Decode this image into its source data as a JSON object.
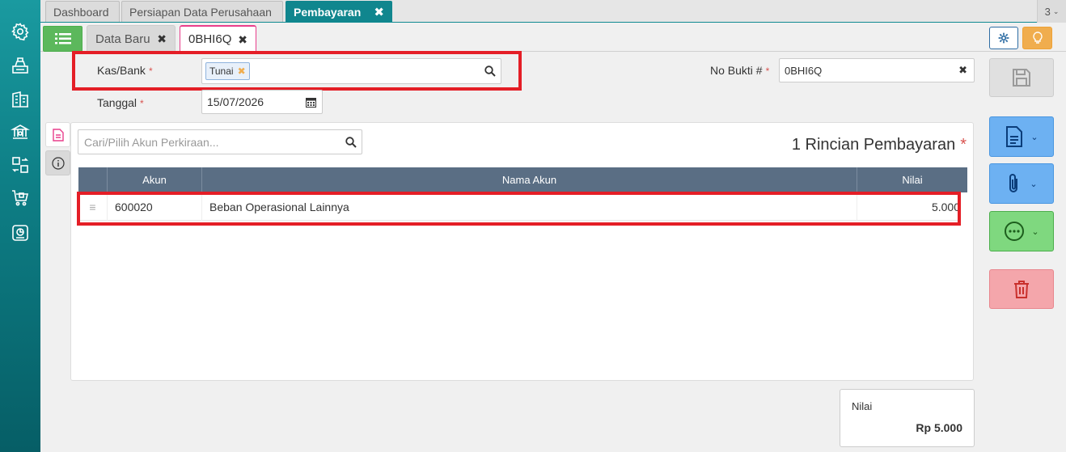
{
  "top_tabs": [
    {
      "label": "Dashboard"
    },
    {
      "label": "Persiapan Data Perusahaan"
    },
    {
      "label": "Pembayaran",
      "close": "✖"
    }
  ],
  "tab_counter": "3",
  "sub_tabs": [
    {
      "label": "Data Baru",
      "close": "✖"
    },
    {
      "label": "0BHI6Q",
      "close": "✖"
    }
  ],
  "form": {
    "kas_bank_label": "Kas/Bank",
    "kas_bank_tag": "Tunai",
    "kas_bank_tag_remove": "✖",
    "tanggal_label": "Tanggal",
    "tanggal_value": "15/07/2026",
    "no_bukti_label": "No Bukti #",
    "no_bukti_value": "0BHI6Q",
    "no_bukti_clear": "✖",
    "required_mark": "*"
  },
  "detail": {
    "search_placeholder": "Cari/Pilih Akun Perkiraan...",
    "title": "1 Rincian Pembayaran",
    "columns": [
      "Akun",
      "Nama Akun",
      "Nilai"
    ],
    "rows": [
      {
        "handle": "≡",
        "akun": "600020",
        "nama_akun": "Beban Operasional Lainnya",
        "nilai": "5.000"
      }
    ]
  },
  "summary": {
    "label": "Nilai",
    "value": "Rp 5.000"
  },
  "colors": {
    "teal": "#10868e",
    "green": "#5cb85c",
    "highlight_red": "#e41e26",
    "blue_btn": "#5ba4f0",
    "orange_btn": "#f0ad4e",
    "table_header": "#5a6e84"
  },
  "icons": [
    "settings-icon",
    "cashier-icon",
    "building-icon",
    "bank-icon",
    "exchange-icon",
    "cart-icon",
    "report-icon",
    "list-icon",
    "gear-icon",
    "lightbulb-icon",
    "save-icon",
    "document-icon",
    "paperclip-icon",
    "more-icon",
    "trash-icon",
    "search-icon",
    "calendar-icon",
    "info-icon"
  ]
}
